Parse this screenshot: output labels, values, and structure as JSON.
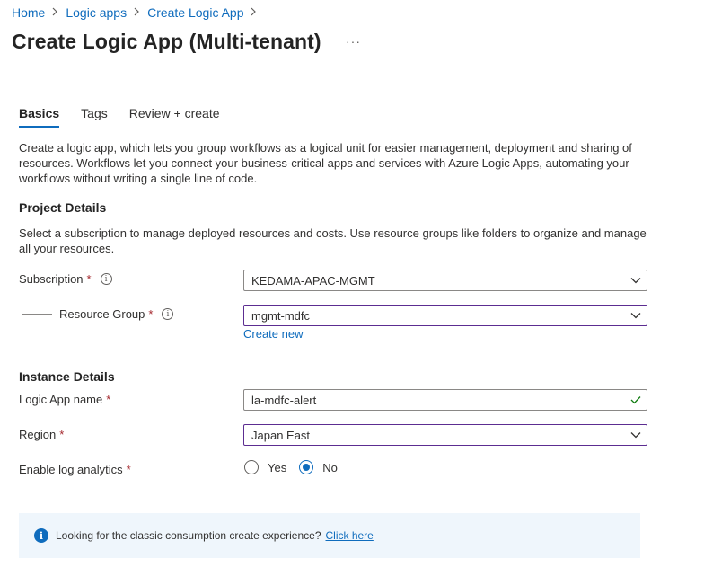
{
  "breadcrumb": {
    "items": [
      "Home",
      "Logic apps",
      "Create Logic App"
    ]
  },
  "page": {
    "title": "Create Logic App (Multi-tenant)",
    "more": "···"
  },
  "tabs": [
    {
      "label": "Basics",
      "active": true
    },
    {
      "label": "Tags",
      "active": false
    },
    {
      "label": "Review + create",
      "active": false
    }
  ],
  "intro": {
    "line1": "Create a logic app, which lets you group workflows as a logical unit for easier management, deployment and sharing of",
    "line2": "resources. Workflows let you connect your business-critical apps and services with Azure Logic Apps, automating your",
    "line3": "workflows without writing a single line of code."
  },
  "project": {
    "heading": "Project Details",
    "desc1": "Select a subscription to manage deployed resources and costs. Use resource groups like folders to organize and manage",
    "desc2": "all your resources.",
    "subscription": {
      "label": "Subscription",
      "value": "KEDAMA-APAC-MGMT"
    },
    "resource_group": {
      "label": "Resource Group",
      "value": "mgmt-mdfc",
      "create_new": "Create new"
    }
  },
  "instance": {
    "heading": "Instance Details",
    "name": {
      "label": "Logic App name",
      "value": "la-mdfc-alert"
    },
    "region": {
      "label": "Region",
      "value": "Japan East"
    },
    "log_analytics": {
      "label": "Enable log analytics",
      "yes": "Yes",
      "no": "No",
      "selected": "No"
    }
  },
  "common": {
    "required": "*",
    "info_glyph": "i"
  },
  "banner": {
    "text": "Looking for the classic consumption create experience?",
    "link": "Click here",
    "icon_glyph": "i"
  },
  "colors": {
    "accent": "#0f6cbd",
    "focus_border": "#5c2d91",
    "required": "#a4262c",
    "banner_bg": "#eff6fc",
    "valid_check": "#107c10"
  }
}
